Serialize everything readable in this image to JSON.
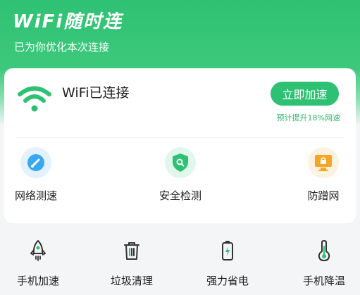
{
  "header": {
    "app_title": "WiFi随时连",
    "subtitle": "已为你优化本次连接"
  },
  "wifi_card": {
    "icon": "wifi-icon",
    "status": "WiFi已连接",
    "speed_button": "立即加速",
    "speed_hint": "预计提升18%网速",
    "features": [
      {
        "label": "网络测速",
        "icon": "speedometer-icon",
        "color": "#3aa8f0"
      },
      {
        "label": "安全检测",
        "icon": "shield-icon",
        "color": "#2fc173"
      },
      {
        "label": "防蹭网",
        "icon": "monitor-lock-icon",
        "color": "#f5a623"
      }
    ]
  },
  "tools": [
    {
      "label": "手机加速",
      "icon": "rocket-icon"
    },
    {
      "label": "垃圾清理",
      "icon": "trash-icon"
    },
    {
      "label": "强力省电",
      "icon": "battery-icon"
    },
    {
      "label": "手机降温",
      "icon": "thermometer-icon"
    }
  ],
  "colors": {
    "brand_green": "#2fc173",
    "hint_green": "#2fb86c",
    "blue": "#3aa8f0",
    "orange": "#f5a623",
    "background": "#f4f5f7"
  }
}
